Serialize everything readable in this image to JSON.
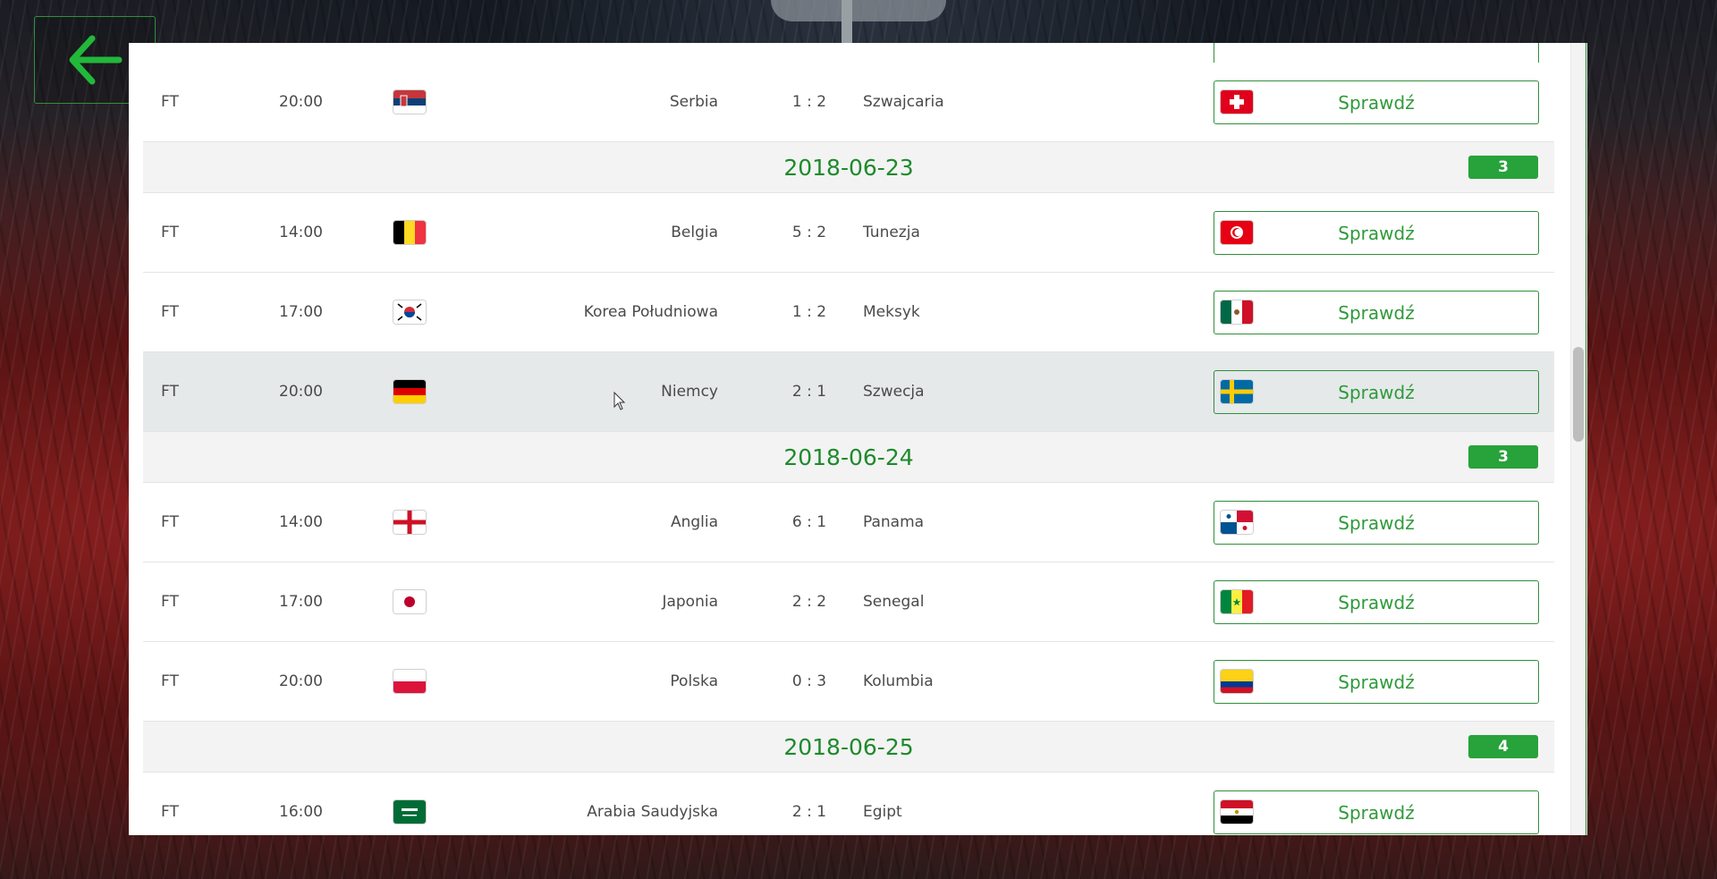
{
  "back_button": {
    "icon": "arrow-left-icon"
  },
  "check_label": "Sprawdź",
  "colors": {
    "accent": "#2f9a3a",
    "badge": "#28a23a",
    "date": "#1e8a2c"
  },
  "rows": [
    {
      "type": "match",
      "status": "FT",
      "time": "20:00",
      "home": "Serbia",
      "home_flag": "serbia-flag-icon",
      "score": "1 : 2",
      "away": "Szwajcaria",
      "away_flag": "switzerland-flag-icon",
      "button": "Sprawdź"
    },
    {
      "type": "date",
      "date": "2018-06-23",
      "count": "3"
    },
    {
      "type": "match",
      "status": "FT",
      "time": "14:00",
      "home": "Belgia",
      "home_flag": "belgium-flag-icon",
      "score": "5 : 2",
      "away": "Tunezja",
      "away_flag": "tunisia-flag-icon",
      "button": "Sprawdź"
    },
    {
      "type": "match",
      "status": "FT",
      "time": "17:00",
      "home": "Korea Południowa",
      "home_flag": "south-korea-flag-icon",
      "score": "1 : 2",
      "away": "Meksyk",
      "away_flag": "mexico-flag-icon",
      "button": "Sprawdź"
    },
    {
      "type": "match",
      "status": "FT",
      "time": "20:00",
      "home": "Niemcy",
      "home_flag": "germany-flag-icon",
      "score": "2 : 1",
      "away": "Szwecja",
      "away_flag": "sweden-flag-icon",
      "button": "Sprawdź",
      "hover": true
    },
    {
      "type": "date",
      "date": "2018-06-24",
      "count": "3"
    },
    {
      "type": "match",
      "status": "FT",
      "time": "14:00",
      "home": "Anglia",
      "home_flag": "england-flag-icon",
      "score": "6 : 1",
      "away": "Panama",
      "away_flag": "panama-flag-icon",
      "button": "Sprawdź"
    },
    {
      "type": "match",
      "status": "FT",
      "time": "17:00",
      "home": "Japonia",
      "home_flag": "japan-flag-icon",
      "score": "2 : 2",
      "away": "Senegal",
      "away_flag": "senegal-flag-icon",
      "button": "Sprawdź"
    },
    {
      "type": "match",
      "status": "FT",
      "time": "20:00",
      "home": "Polska",
      "home_flag": "poland-flag-icon",
      "score": "0 : 3",
      "away": "Kolumbia",
      "away_flag": "colombia-flag-icon",
      "button": "Sprawdź"
    },
    {
      "type": "date",
      "date": "2018-06-25",
      "count": "4"
    },
    {
      "type": "match",
      "status": "FT",
      "time": "16:00",
      "home": "Arabia Saudyjska",
      "home_flag": "saudi-arabia-flag-icon",
      "score": "2 : 1",
      "away": "Egipt",
      "away_flag": "egypt-flag-icon",
      "button": "Sprawdź"
    }
  ]
}
